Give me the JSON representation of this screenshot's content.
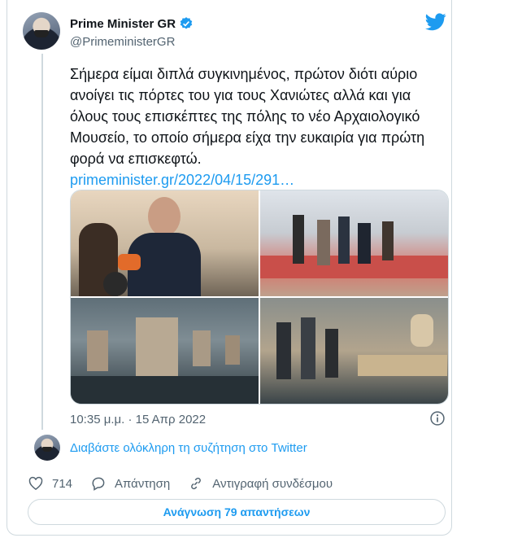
{
  "author": {
    "name": "Prime Minister GR",
    "handle": "@PrimeministerGR"
  },
  "tweet": {
    "text": "Σήμερα είμαι διπλά συγκινημένος, πρώτον διότι αύριο ανοίγει τις πόρτες του για τους Χανιώτες αλλά και για όλους τους επισκέπτες της πόλης το νέο Αρχαιολογικό Μουσείο, το οποίο σήμερα είχα την ευκαιρία για πρώτη φορά να επισκεφτώ.",
    "link": "primeminister.gr/2022/04/15/291…",
    "timestamp": "10:35 μ.μ. · 15 Απρ 2022"
  },
  "conversation_link": "Διαβάστε ολόκληρη τη συζήτηση στο Twitter",
  "actions": {
    "likes": "714",
    "reply_label": "Απάντηση",
    "copy_link_label": "Αντιγραφή συνδέσμου"
  },
  "replies_button": "Ανάγνωση 79 απαντήσεων",
  "icons": [
    "verified-icon",
    "twitter-logo-icon",
    "info-icon",
    "heart-icon",
    "reply-icon",
    "link-icon"
  ],
  "colors": {
    "accent": "#1d9bf0",
    "text": "#0f1419",
    "secondary": "#536471",
    "border": "#cfd9de"
  }
}
